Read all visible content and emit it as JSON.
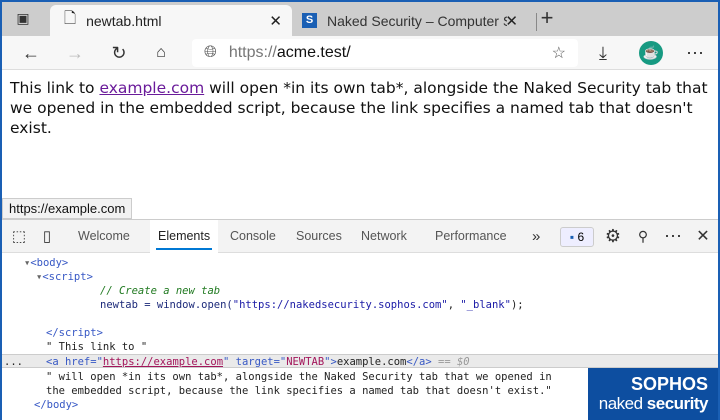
{
  "browser": {
    "tabs": [
      {
        "title": "newtab.html",
        "icon": "document-icon",
        "active": true
      },
      {
        "title": "Naked Security – Computer S",
        "icon": "sophos-s-icon",
        "active": false
      }
    ],
    "new_tab": "+",
    "url_scheme": "https://",
    "url_host": "acme.test/"
  },
  "page": {
    "text_before": "This link to ",
    "link": "example.com",
    "text_after": " will open *in its own tab*, alongside the Naked Security tab that we opened in the embedded script, because the link specifies a named tab that doesn't exist.",
    "status_url": "https://example.com"
  },
  "devtools": {
    "tabs": [
      "Welcome",
      "Elements",
      "Console",
      "Sources",
      "Network",
      "Performance"
    ],
    "active_tab": "Elements",
    "more": "»",
    "issues_count": "6",
    "lines": {
      "body": "<body>",
      "script": "<script>",
      "comment": "// Create a new tab",
      "code_a": "newtab = window.open(",
      "code_url": "\"https://nakedsecurity.sophos.com\"",
      "code_b": ", ",
      "code_blank": "\"_blank\"",
      "code_c": ");",
      "script_end": "</script>",
      "text1": "\" This link to \"",
      "a_open": "<a href=\"",
      "a_href": "https://example.com",
      "a_mid": "\" target=\"",
      "a_target": "NEWTAB",
      "a_close": "\">",
      "a_text": "example.com",
      "a_end": "</a>",
      "a_sel": " == $0",
      "text2": "\" will open *in its own tab*, alongside the Naked Security tab that we opened in",
      "text3": "the embedded script, because the link specifies a named tab that doesn't exist.\"",
      "body_end": "</body>",
      "dots": "..."
    }
  },
  "watermark": {
    "line1": "SOPHOS",
    "line2a": "naked ",
    "line2b": "security"
  },
  "colors": {
    "frame": "#1a5fb4",
    "accent": "#0078d4",
    "link": "#6a1b9a",
    "logo_bg": "#0d4ea0"
  }
}
